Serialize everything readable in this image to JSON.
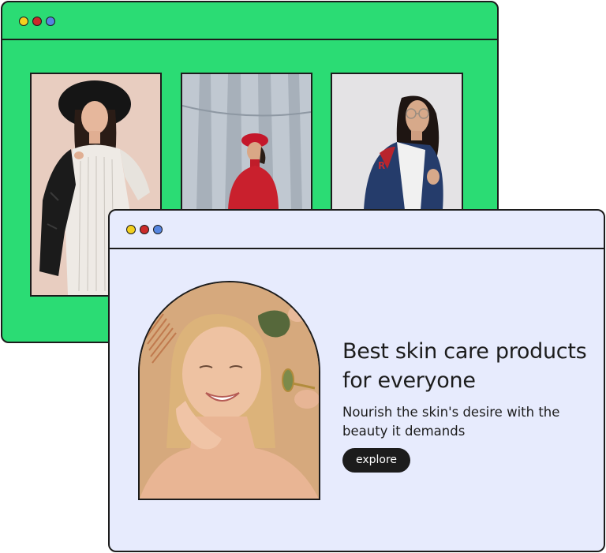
{
  "colors": {
    "back_window_bg": "#2bdc74",
    "front_window_bg": "#e7ebfd",
    "outline": "#1c1c1c",
    "dot_yellow": "#f3d01f",
    "dot_red": "#cc2a2a",
    "dot_blue": "#5585e0",
    "button_bg": "#1c1c1c",
    "button_text": "#ffffff"
  },
  "back_window": {
    "window_controls": [
      "yellow-dot",
      "red-dot",
      "blue-dot"
    ],
    "gallery": [
      {
        "icon": "woman-black-hat-leather-jacket-photo"
      },
      {
        "icon": "woman-red-beret-red-sweater-photo"
      },
      {
        "icon": "woman-glasses-varsity-jacket-photo"
      }
    ]
  },
  "front_window": {
    "window_controls": [
      "yellow-dot",
      "red-dot",
      "blue-dot"
    ],
    "hero_image": {
      "icon": "smiling-woman-with-face-roller-photo"
    },
    "headline_line1": "Best skin care products",
    "headline_line2": "for everyone",
    "subtitle_line1": "Nourish the skin's desire with the",
    "subtitle_line2": "beauty it demands",
    "button_label": "explore"
  }
}
